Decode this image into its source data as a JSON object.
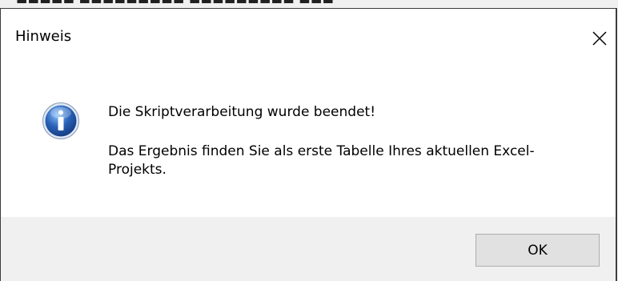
{
  "dialog": {
    "title": "Hinweis",
    "close_icon": "close-icon",
    "message_icon": "info-icon",
    "message_line_1": "Die Skriptverarbeitung wurde beendet!",
    "message_line_2": "Das Ergebnis finden Sie als erste Tabelle Ihres aktuellen Excel-Projekts.",
    "ok_label": "OK"
  },
  "colors": {
    "icon_blue": "#2a63b8",
    "footer_bg": "#f0f0f0",
    "button_bg": "#e1e1e1"
  }
}
